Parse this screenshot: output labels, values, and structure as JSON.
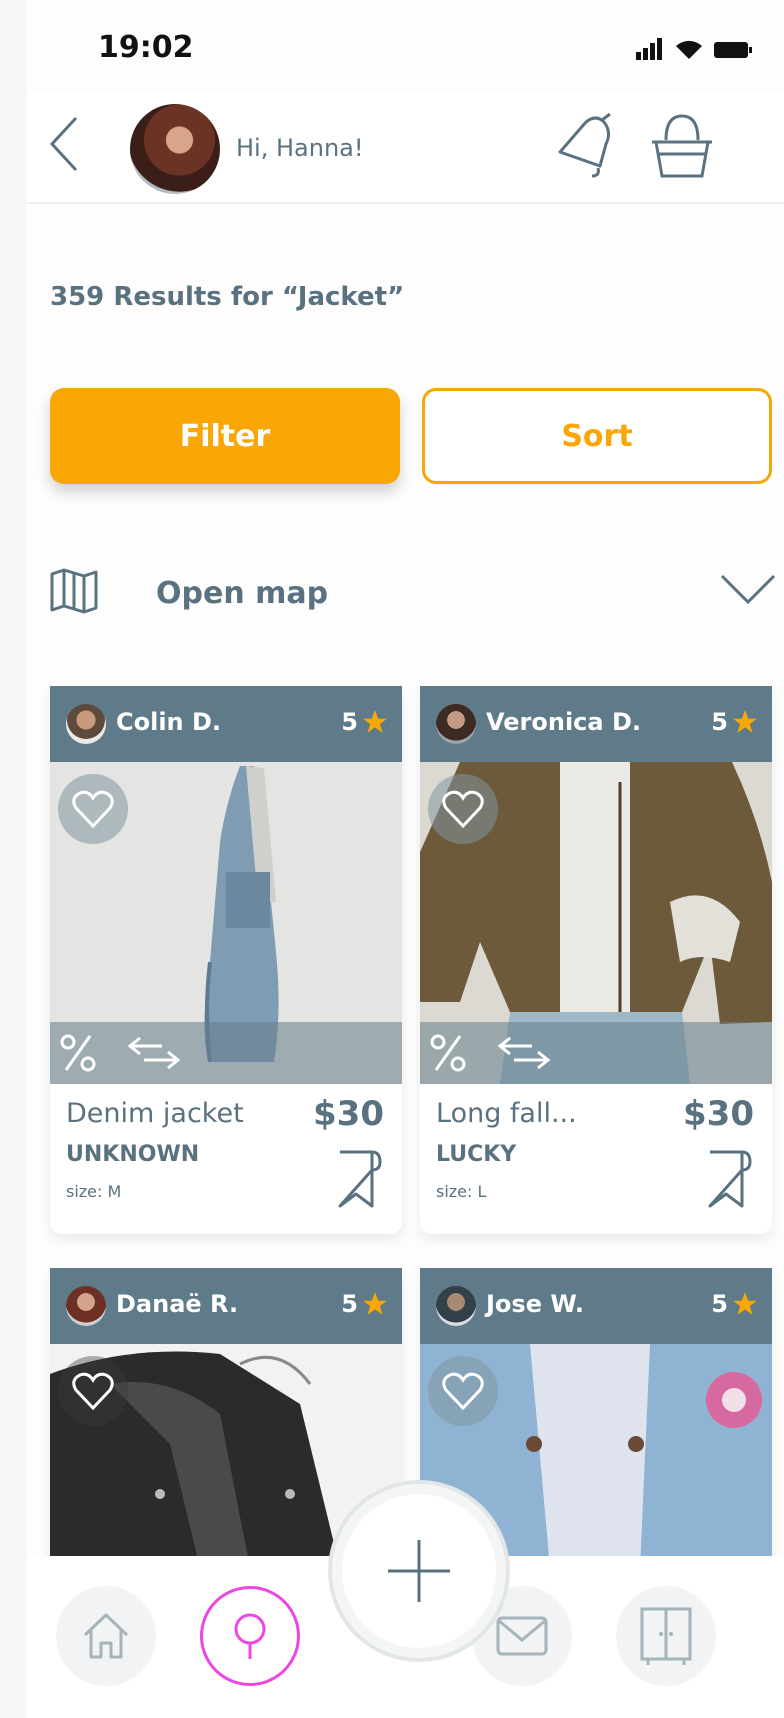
{
  "status": {
    "time": "19:02"
  },
  "header": {
    "greeting": "Hi, Hanna!"
  },
  "results": {
    "text": "359 Results for “Jacket”"
  },
  "actions": {
    "filter": "Filter",
    "sort": "Sort"
  },
  "map": {
    "label": "Open map"
  },
  "listings": [
    {
      "user": "Colin D.",
      "rating": "5",
      "name": "Denim jacket",
      "price": "$30",
      "brand": "UNKNOWN",
      "size": "size: M"
    },
    {
      "user": "Veronica D.",
      "rating": "5",
      "name": "Long fall...",
      "price": "$30",
      "brand": "LUCKY",
      "size": "size: L"
    },
    {
      "user": "Danaë R.",
      "rating": "5"
    },
    {
      "user": "Jose W.",
      "rating": "5"
    }
  ],
  "colors": {
    "accent": "#f8a706",
    "card_header": "#5f7a89",
    "text": "#5a7180",
    "search_active": "#ee45e5"
  },
  "icons": [
    "back-icon",
    "bell-icon",
    "basket-icon",
    "map-icon",
    "chevron-down-icon",
    "heart-icon",
    "discount-icon",
    "swap-icon",
    "bookmark-icon",
    "star-icon",
    "home-icon",
    "search-icon",
    "plus-icon",
    "mail-icon",
    "wardrobe-icon"
  ]
}
